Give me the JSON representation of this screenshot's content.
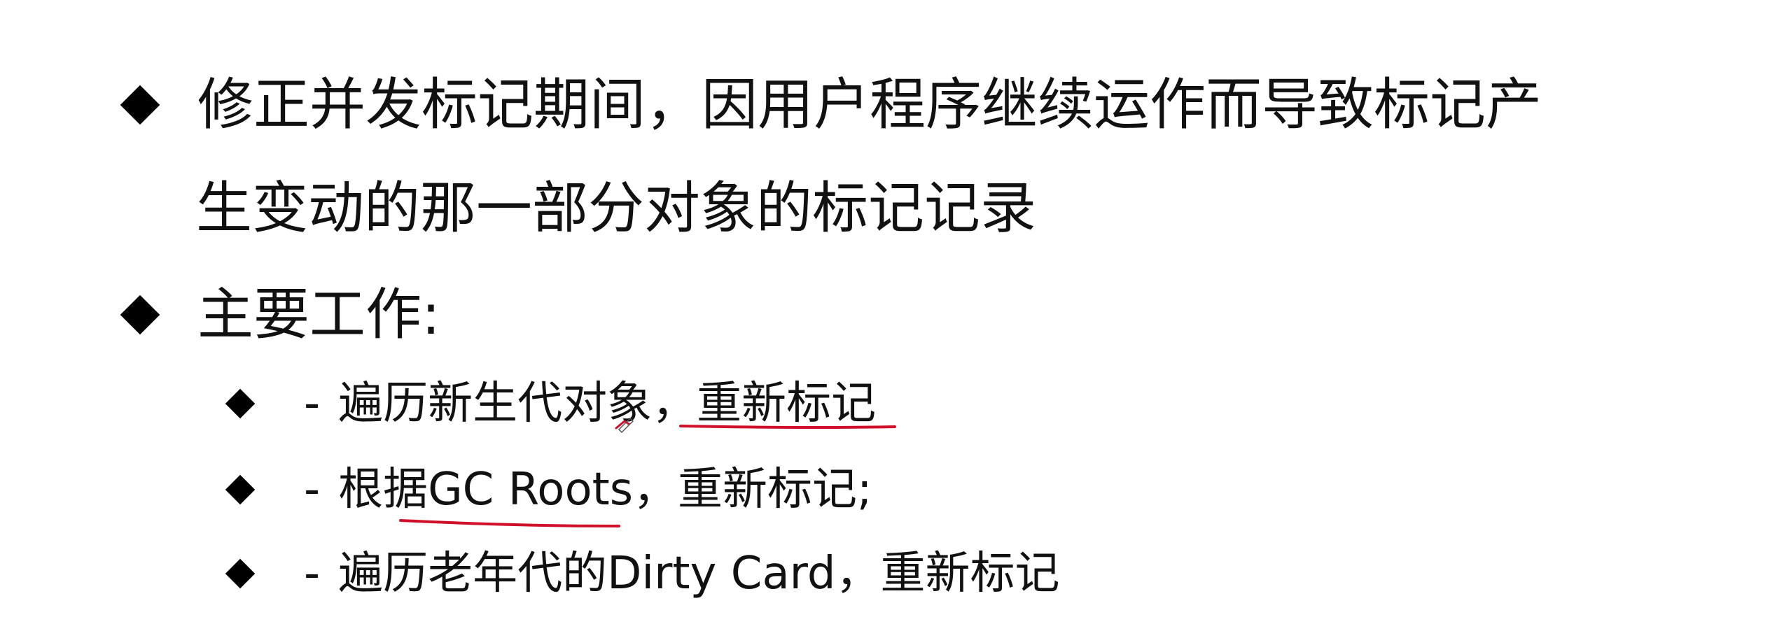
{
  "bullets": [
    {
      "line1": "修正并发标记期间，因用户程序继续运作而导致标记产",
      "line2": "生变动的那一部分对象的标记记录"
    },
    {
      "line1": "主要工作:"
    }
  ],
  "sub_bullets": [
    {
      "dash": "-",
      "text": "遍历新生代对象，重新标记"
    },
    {
      "dash": "-",
      "text": "根据GC Roots，重新标记;"
    },
    {
      "dash": "-",
      "text": "遍历老年代的Dirty Card，重新标记"
    }
  ],
  "colors": {
    "text": "#111111",
    "bullet": "#000000",
    "annotation": "#d0102a"
  }
}
